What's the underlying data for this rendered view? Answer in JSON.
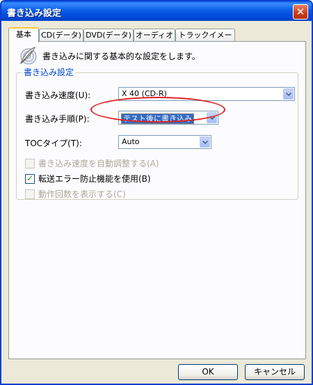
{
  "window": {
    "title": "書き込み設定",
    "close_icon": "close-icon"
  },
  "tabs": [
    {
      "label": "基本",
      "active": true
    },
    {
      "label": "CD(データ)"
    },
    {
      "label": "DVD(データ)"
    },
    {
      "label": "オーディオ"
    },
    {
      "label": "トラックイメージ"
    }
  ],
  "panel": {
    "hint": "書き込みに関する基本的な設定をします。",
    "hint_icon": "disc-feather-icon",
    "group_title": "書き込み設定",
    "write_speed": {
      "label": "書き込み速度(U):",
      "value": "X 40 (CD-R)"
    },
    "write_method": {
      "label": "書き込み手順(P):",
      "value": "テスト後に書き込み"
    },
    "toc_type": {
      "label": "TOCタイプ(T):",
      "value": "Auto"
    },
    "options": [
      {
        "label": "書き込み速度を自動調整する(A)",
        "checked": false,
        "enabled": false
      },
      {
        "label": "転送エラー防止機能を使用(B)",
        "checked": true,
        "enabled": true
      },
      {
        "label": "動作回数を表示する(C)",
        "checked": false,
        "enabled": false
      }
    ]
  },
  "buttons": {
    "ok": "OK",
    "cancel": "キャンセル"
  },
  "colors": {
    "title_bar": "#0054e3",
    "group_title": "#0046d5",
    "highlight": "#316ac5",
    "annotation": "#e02222"
  }
}
